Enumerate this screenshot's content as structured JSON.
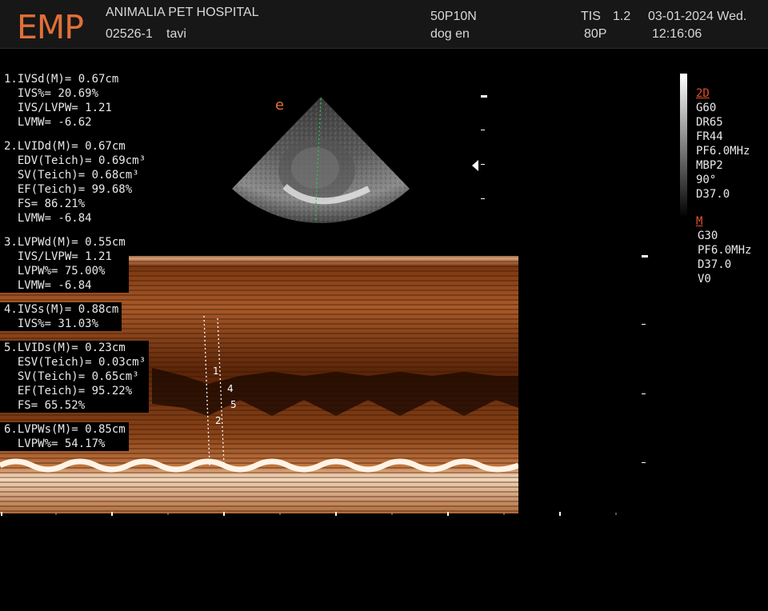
{
  "header": {
    "logo": "EMP",
    "hospital": "ANIMALIA PET HOSPITAL",
    "patient_id": "02526-1",
    "patient_name": "tavi",
    "probe": "50P10N",
    "exam": "dog en",
    "tis_label": "TIS",
    "tis_value": "1.2",
    "power": "80P",
    "date": "03-01-2024 Wed.",
    "time": "12:16:06"
  },
  "measurements": [
    [
      "1.IVSd(M)= 0.67cm",
      "  IVS%= 20.69%",
      "  IVS/LVPW= 1.21",
      "  LVMW= -6.62"
    ],
    [
      "2.LVIDd(M)= 0.67cm",
      "  EDV(Teich)= 0.69cm³",
      "  SV(Teich)= 0.68cm³",
      "  EF(Teich)= 99.68%",
      "  FS= 86.21%",
      "  LVMW= -6.84"
    ],
    [
      "3.LVPWd(M)= 0.55cm",
      "  IVS/LVPW= 1.21",
      "  LVPW%= 75.00%",
      "  LVMW= -6.84"
    ],
    [
      "4.IVSs(M)= 0.88cm",
      "  IVS%= 31.03%"
    ],
    [
      "5.LVIDs(M)= 0.23cm",
      "  ESV(Teich)= 0.03cm³",
      "  SV(Teich)= 0.65cm³",
      "  EF(Teich)= 95.22%",
      "  FS= 65.52%"
    ],
    [
      "6.LVPWs(M)= 0.85cm",
      "  LVPW%= 54.17%"
    ]
  ],
  "params_2d": {
    "title": "2D",
    "items": [
      "G60",
      "DR65",
      "FR44",
      "PF6.0MHz",
      "MBP2",
      "90°",
      "D37.0"
    ]
  },
  "params_m": {
    "title": "M",
    "items": [
      "G30",
      "PF6.0MHz",
      "D37.0",
      "V0"
    ]
  },
  "orientation_marker": "e",
  "caliper_labels": [
    "1",
    "2",
    "4",
    "5"
  ],
  "colors": {
    "accent": "#e0502a",
    "mmode_bg": "#6a2a0c",
    "mmode_bright": "#f5d2b0"
  }
}
